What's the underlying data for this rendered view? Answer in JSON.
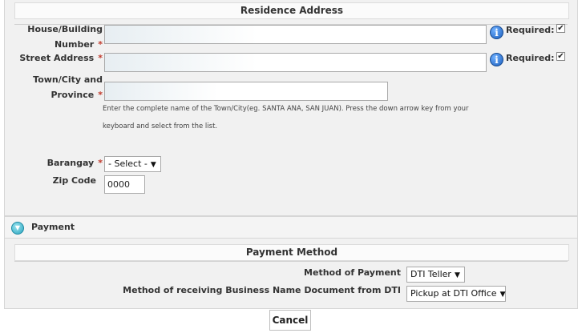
{
  "residence": {
    "header": "Residence Address",
    "house": {
      "label_line1": "House/Building",
      "label_line2": "Number",
      "value": "",
      "required_label": "Required:",
      "required_checked": true
    },
    "street": {
      "label": "Street Address",
      "value": "",
      "required_label": "Required:",
      "required_checked": true
    },
    "town": {
      "label_line1": "Town/City and",
      "label_line2": "Province",
      "value": "",
      "help_line1": "Enter the complete name of the Town/City(eg. SANTA ANA, SAN JUAN). Press the down arrow key from your",
      "help_line2": "keyboard and select from the list."
    },
    "barangay": {
      "label": "Barangay",
      "selected": "- Select -"
    },
    "zip": {
      "label": "Zip Code",
      "value": "0000"
    },
    "required_marker": "*",
    "info_glyph": "i",
    "check_glyph": "✔"
  },
  "payment": {
    "section_title": "Payment",
    "toggle_glyph": "▼",
    "header": "Payment Method",
    "method": {
      "label": "Method of Payment",
      "selected": "DTI Teller"
    },
    "receiving": {
      "label": "Method of receiving Business Name Document from DTI",
      "selected": "Pickup at DTI Office"
    },
    "arrow_glyph": "▼"
  },
  "actions": {
    "cancel_label": "Cancel"
  },
  "colors": {
    "required_star": "#c0392b",
    "info_icon": "#1c5fbd",
    "toggle_icon": "#2aa5bf"
  },
  "icons": {
    "info": "info-icon",
    "toggle": "collapse-toggle-icon",
    "check": "checkmark-icon"
  }
}
